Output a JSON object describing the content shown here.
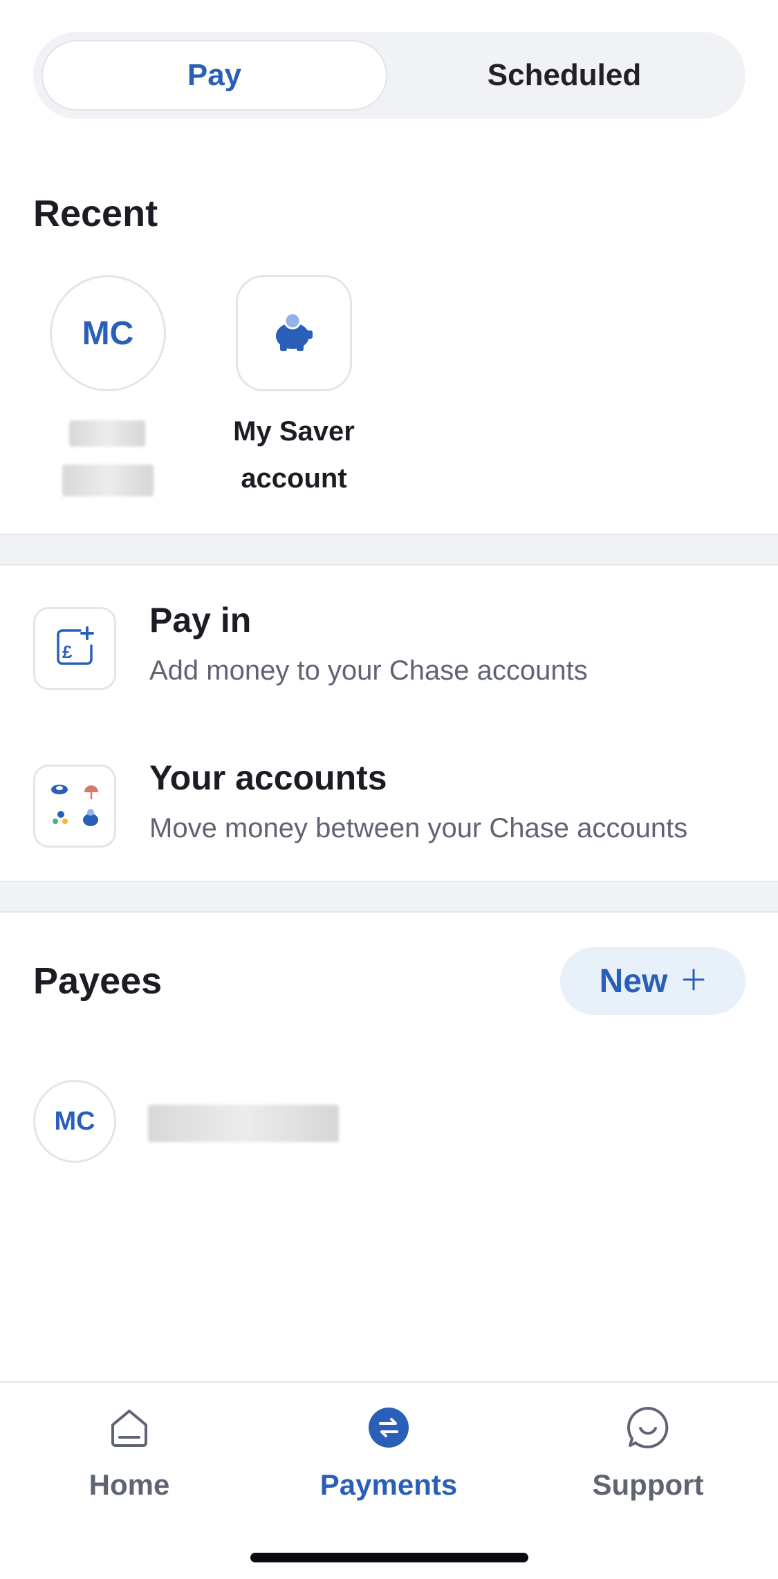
{
  "segmented_control": {
    "tabs": [
      {
        "label": "Pay",
        "active": true
      },
      {
        "label": "Scheduled",
        "active": false
      }
    ]
  },
  "recent": {
    "title": "Recent",
    "items": [
      {
        "initials": "MC",
        "name_hidden": true
      },
      {
        "icon": "piggy-bank-icon",
        "label_line1": "My Saver",
        "label_line2": "account"
      }
    ]
  },
  "actions": [
    {
      "title": "Pay in",
      "subtitle": "Add money to your Chase accounts",
      "icon": "pound-plus-icon"
    },
    {
      "title": "Your accounts",
      "subtitle": "Move money between your Chase accounts",
      "icon": "accounts-grid-icon"
    }
  ],
  "payees": {
    "title": "Payees",
    "new_button_label": "New",
    "new_button_icon": "plus-icon",
    "items": [
      {
        "initials": "MC",
        "name_hidden": true
      }
    ]
  },
  "bottom_nav": {
    "items": [
      {
        "label": "Home",
        "icon": "home-icon",
        "active": false
      },
      {
        "label": "Payments",
        "icon": "transfer-icon",
        "active": true
      },
      {
        "label": "Support",
        "icon": "chat-smile-icon",
        "active": false
      }
    ]
  },
  "colors": {
    "accent": "#2a5fb8",
    "muted_text": "#5f6472",
    "divider": "#f1f2f5",
    "new_button_bg": "#e8f0fa"
  }
}
